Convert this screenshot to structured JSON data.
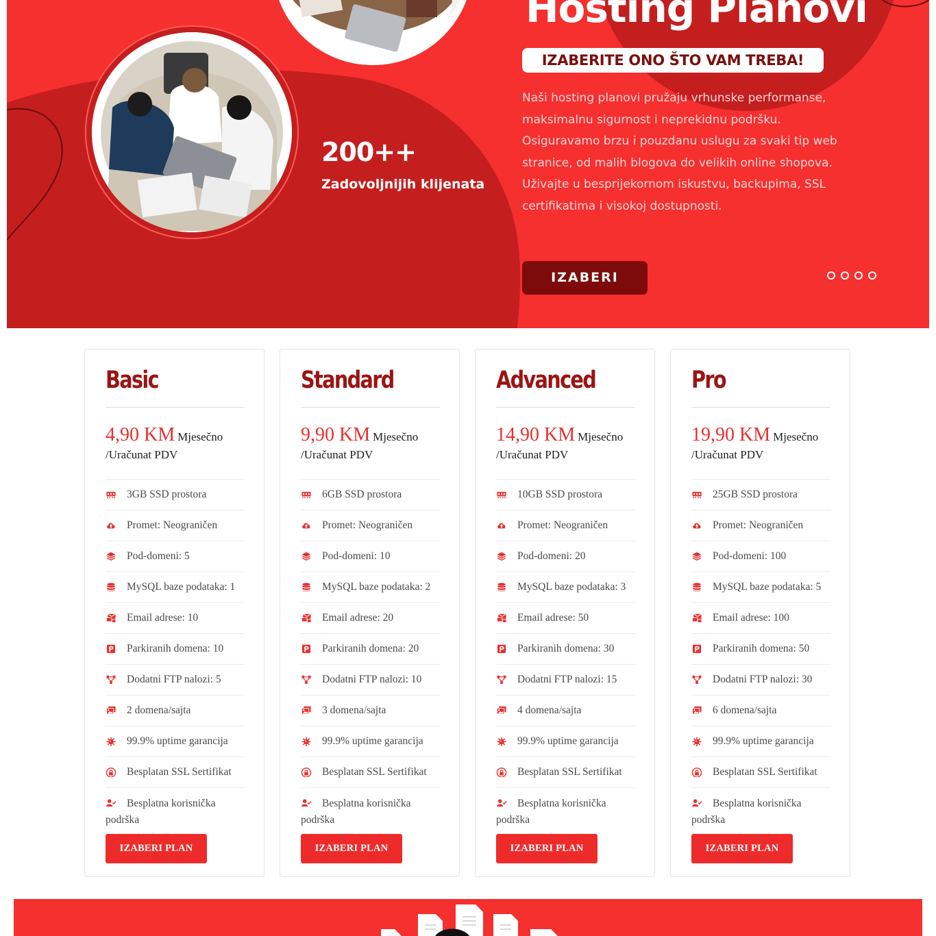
{
  "hero": {
    "title": "Hosting Planovi",
    "tagline": "IZABERITE ONO ŠTO VAM TREBA!",
    "description": "Naši hosting planovi pružaju vrhunske performanse, maksimalnu sigurnost i neprekidnu podršku. Osiguravamo brzu i pouzdanu uslugu za svaki tip web stranice, od malih blogova do velikih online shopova. Uživajte u besprijekornom iskustvu, backupima, SSL certifikatima i visokoj dostupnosti.",
    "stat_value": "200++",
    "stat_label": "Zadovoljnijih klijenata",
    "cta_label": "IZABERI",
    "slide_count": 4,
    "colors": {
      "primary": "#f62f2f",
      "dark": "#c41e1e",
      "button": "#7d0b0b"
    }
  },
  "plans": [
    {
      "name": "Basic",
      "price": "4,90 KM",
      "period": "Mjesečno",
      "vat": "/Uračunat PDV",
      "features": [
        {
          "icon": "memory-icon",
          "text": "3GB SSD prostora"
        },
        {
          "icon": "cloud-upload-icon",
          "text": "Promet: Neograničen"
        },
        {
          "icon": "layers-icon",
          "text": "Pod-domeni: 5"
        },
        {
          "icon": "database-icon",
          "text": "MySQL baze podataka: 1"
        },
        {
          "icon": "mail-bulk-icon",
          "text": "Email adrese: 10"
        },
        {
          "icon": "parking-icon",
          "text": "Parkiranih domena: 10"
        },
        {
          "icon": "network-icon",
          "text": "Dodatni FTP nalozi: 5"
        },
        {
          "icon": "images-icon",
          "text": "2 domena/sajta"
        },
        {
          "icon": "virus-icon",
          "text": "99.9% uptime garancija"
        },
        {
          "icon": "ssl-lock-icon",
          "text": "Besplatan SSL Sertifikat"
        },
        {
          "icon": "user-check-icon",
          "text": "Besplatna korisnička podrška"
        }
      ],
      "button": "IZABERI PLAN"
    },
    {
      "name": "Standard",
      "price": "9,90 KM",
      "period": "Mjesečno",
      "vat": "/Uračunat PDV",
      "features": [
        {
          "icon": "memory-icon",
          "text": "6GB SSD prostora"
        },
        {
          "icon": "cloud-upload-icon",
          "text": "Promet: Neograničen"
        },
        {
          "icon": "layers-icon",
          "text": "Pod-domeni: 10"
        },
        {
          "icon": "database-icon",
          "text": "MySQL baze podataka: 2"
        },
        {
          "icon": "mail-bulk-icon",
          "text": "Email adrese: 20"
        },
        {
          "icon": "parking-icon",
          "text": "Parkiranih domena: 20"
        },
        {
          "icon": "network-icon",
          "text": "Dodatni FTP nalozi: 10"
        },
        {
          "icon": "images-icon",
          "text": "3 domena/sajta"
        },
        {
          "icon": "virus-icon",
          "text": "99.9% uptime garancija"
        },
        {
          "icon": "ssl-lock-icon",
          "text": "Besplatan SSL Sertifikat"
        },
        {
          "icon": "user-check-icon",
          "text": "Besplatna korisnička podrška"
        }
      ],
      "button": "IZABERI PLAN"
    },
    {
      "name": "Advanced",
      "price": "14,90 KM",
      "period": "Mjesečno",
      "vat": "/Uračunat PDV",
      "features": [
        {
          "icon": "memory-icon",
          "text": "10GB SSD prostora"
        },
        {
          "icon": "cloud-upload-icon",
          "text": "Promet: Neograničen"
        },
        {
          "icon": "layers-icon",
          "text": "Pod-domeni: 20"
        },
        {
          "icon": "database-icon",
          "text": "MySQL baze podataka: 3"
        },
        {
          "icon": "mail-bulk-icon",
          "text": "Email adrese: 50"
        },
        {
          "icon": "parking-icon",
          "text": "Parkiranih domena: 30"
        },
        {
          "icon": "network-icon",
          "text": "Dodatni FTP nalozi: 15"
        },
        {
          "icon": "images-icon",
          "text": "4 domena/sajta"
        },
        {
          "icon": "virus-icon",
          "text": "99.9% uptime garancija"
        },
        {
          "icon": "ssl-lock-icon",
          "text": "Besplatan SSL Sertifikat"
        },
        {
          "icon": "user-check-icon",
          "text": "Besplatna korisnička podrška"
        }
      ],
      "button": "IZABERI PLAN"
    },
    {
      "name": "Pro",
      "price": "19,90 KM",
      "period": "Mjesečno",
      "vat": "/Uračunat PDV",
      "features": [
        {
          "icon": "memory-icon",
          "text": "25GB SSD prostora"
        },
        {
          "icon": "cloud-upload-icon",
          "text": "Promet: Neograničen"
        },
        {
          "icon": "layers-icon",
          "text": "Pod-domeni: 100"
        },
        {
          "icon": "database-icon",
          "text": "MySQL baze podataka: 5"
        },
        {
          "icon": "mail-bulk-icon",
          "text": "Email adrese: 100"
        },
        {
          "icon": "parking-icon",
          "text": "Parkiranih domena: 50"
        },
        {
          "icon": "network-icon",
          "text": "Dodatni FTP nalozi: 30"
        },
        {
          "icon": "images-icon",
          "text": "6 domena/sajta"
        },
        {
          "icon": "virus-icon",
          "text": "99.9% uptime garancija"
        },
        {
          "icon": "ssl-lock-icon",
          "text": "Besplatan SSL Sertifikat"
        },
        {
          "icon": "user-check-icon",
          "text": "Besplatna korisnička podrška"
        }
      ],
      "button": "IZABERI PLAN"
    }
  ],
  "theme": {
    "accent": "#e8302f",
    "plan_title": "#9b1414"
  }
}
